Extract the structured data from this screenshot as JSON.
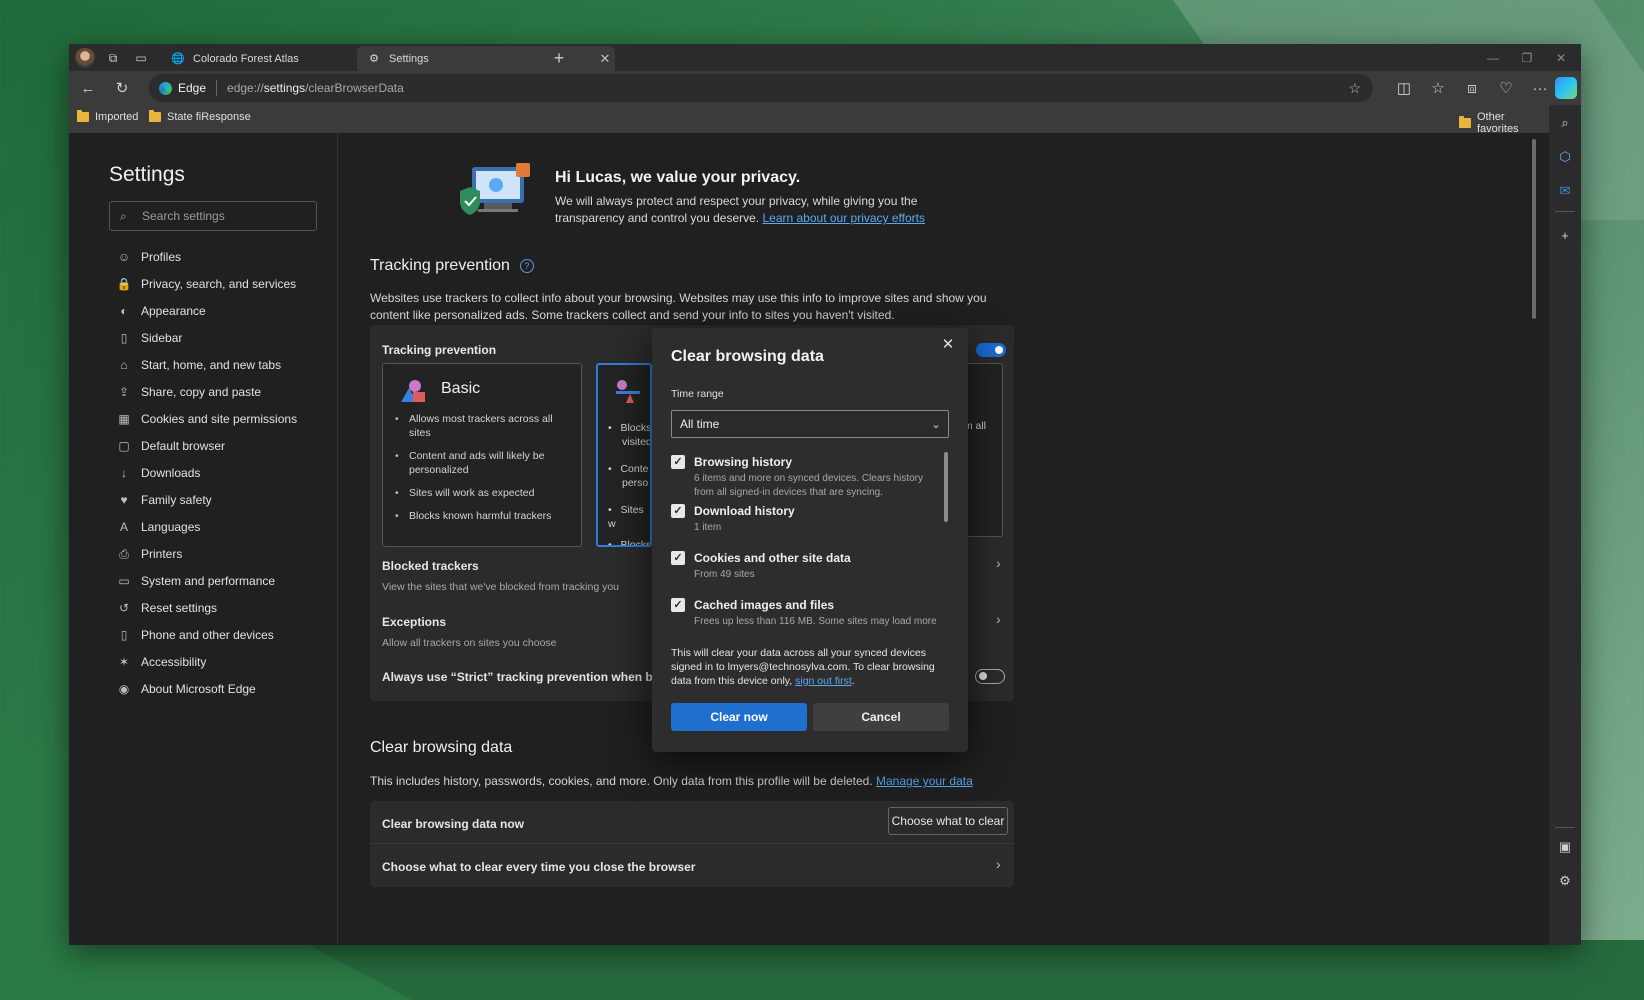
{
  "browser": {
    "tabs": [
      {
        "label": "Colorado Forest Atlas",
        "icon": "globe-icon"
      },
      {
        "label": "Settings",
        "icon": "gear-icon"
      }
    ],
    "address": {
      "badge": "Edge",
      "url_prefix": "edge://",
      "url_bold": "settings",
      "url_suffix": "/clearBrowserData"
    },
    "favorites": {
      "left": [
        "Imported",
        "State fiResponse"
      ],
      "right": "Other favorites"
    }
  },
  "sidebar": {
    "title": "Settings",
    "search_placeholder": "Search settings",
    "items": [
      {
        "label": "Profiles",
        "icon": "profile-icon"
      },
      {
        "label": "Privacy, search, and services",
        "icon": "lock-icon"
      },
      {
        "label": "Appearance",
        "icon": "palette-icon"
      },
      {
        "label": "Sidebar",
        "icon": "sidebar-icon"
      },
      {
        "label": "Start, home, and new tabs",
        "icon": "home-icon"
      },
      {
        "label": "Share, copy and paste",
        "icon": "share-icon"
      },
      {
        "label": "Cookies and site permissions",
        "icon": "cookie-icon"
      },
      {
        "label": "Default browser",
        "icon": "browser-icon"
      },
      {
        "label": "Downloads",
        "icon": "download-icon"
      },
      {
        "label": "Family safety",
        "icon": "family-icon"
      },
      {
        "label": "Languages",
        "icon": "language-icon"
      },
      {
        "label": "Printers",
        "icon": "printer-icon"
      },
      {
        "label": "System and performance",
        "icon": "system-icon"
      },
      {
        "label": "Reset settings",
        "icon": "reset-icon"
      },
      {
        "label": "Phone and other devices",
        "icon": "phone-icon"
      },
      {
        "label": "Accessibility",
        "icon": "accessibility-icon"
      },
      {
        "label": "About Microsoft Edge",
        "icon": "edge-icon"
      }
    ]
  },
  "main": {
    "hero": {
      "title": "Hi Lucas, we value your privacy.",
      "text": "We will always protect and respect your privacy, while giving you the transparency and control you deserve.",
      "link": "Learn about our privacy efforts"
    },
    "tracking": {
      "heading": "Tracking prevention",
      "para": "Websites use trackers to collect info about your browsing. Websites may use this info to improve sites and show you content like personalized ads. Some trackers collect and send your info to sites you haven't visited.",
      "card_title": "Tracking prevention",
      "basic": {
        "title": "Basic",
        "bullets": [
          "Allows most trackers across all sites",
          "Content and ads will likely be personalized",
          "Sites will work as expected",
          "Blocks known harmful trackers"
        ]
      },
      "balanced_partial": [
        "Blocks",
        "visited",
        "Conte",
        "perso",
        "Sites w",
        "Blocks"
      ],
      "strict_partial": [
        "om all",
        "e"
      ],
      "blocked_trackers": {
        "title": "Blocked trackers",
        "sub": "View the sites that we've blocked from tracking you"
      },
      "exceptions": {
        "title": "Exceptions",
        "sub": "Allow all trackers on sites you choose"
      },
      "strict_inprivate": "Always use “Strict” tracking prevention when browsi"
    },
    "clear": {
      "heading": "Clear browsing data",
      "para": "This includes history, passwords, cookies, and more. Only data from this profile will be deleted.",
      "link": "Manage your data",
      "row1": "Clear browsing data now",
      "row1_button": "Choose what to clear",
      "row2": "Choose what to clear every time you close the browser"
    }
  },
  "dialog": {
    "title": "Clear browsing data",
    "time_range_label": "Time range",
    "time_range_value": "All time",
    "items": [
      {
        "label": "Browsing history",
        "desc": "6 items and more on synced devices. Clears history from all signed-in devices that are syncing.",
        "checked": true
      },
      {
        "label": "Download history",
        "desc": "1 item",
        "checked": true
      },
      {
        "label": "Cookies and other site data",
        "desc": "From 49 sites",
        "checked": true
      },
      {
        "label": "Cached images and files",
        "desc": "Frees up less than 116 MB. Some sites may load more",
        "checked": true
      }
    ],
    "note_text": "This will clear your data across all your synced devices signed in to lmyers@technosylva.com. To clear browsing data from this device only,",
    "note_link": "sign out first",
    "note_end": ".",
    "clear_button": "Clear now",
    "cancel_button": "Cancel"
  },
  "colors": {
    "accent": "#1f6fcf",
    "link": "#5aa9f2",
    "background": "#202020"
  }
}
